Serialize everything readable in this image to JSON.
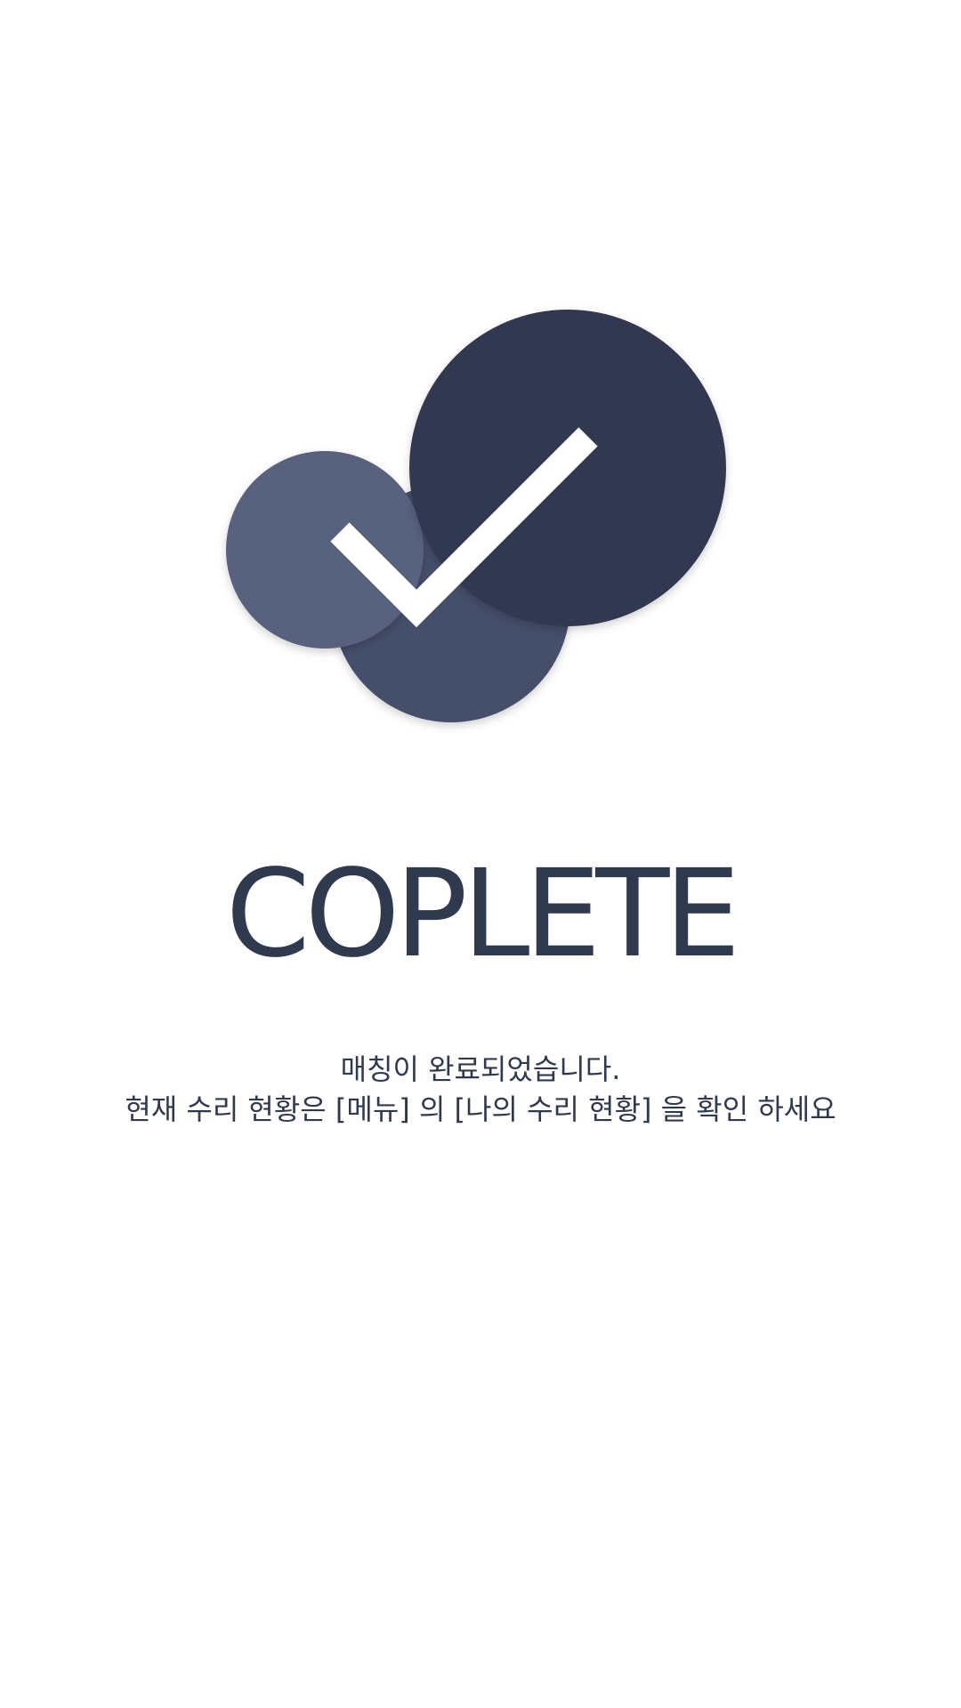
{
  "illustration": {
    "icon": "check-icon",
    "colors": {
      "large_circle": "#303950",
      "medium_circle": "#45506b",
      "small_circle": "#58627f",
      "check_mark": "#ffffff"
    }
  },
  "title": "COPLETE",
  "message": {
    "line1": "매칭이 완료되었습니다.",
    "line2": "현재 수리 현황은 [메뉴] 의 [나의 수리 현황] 을 확인 하세요"
  }
}
